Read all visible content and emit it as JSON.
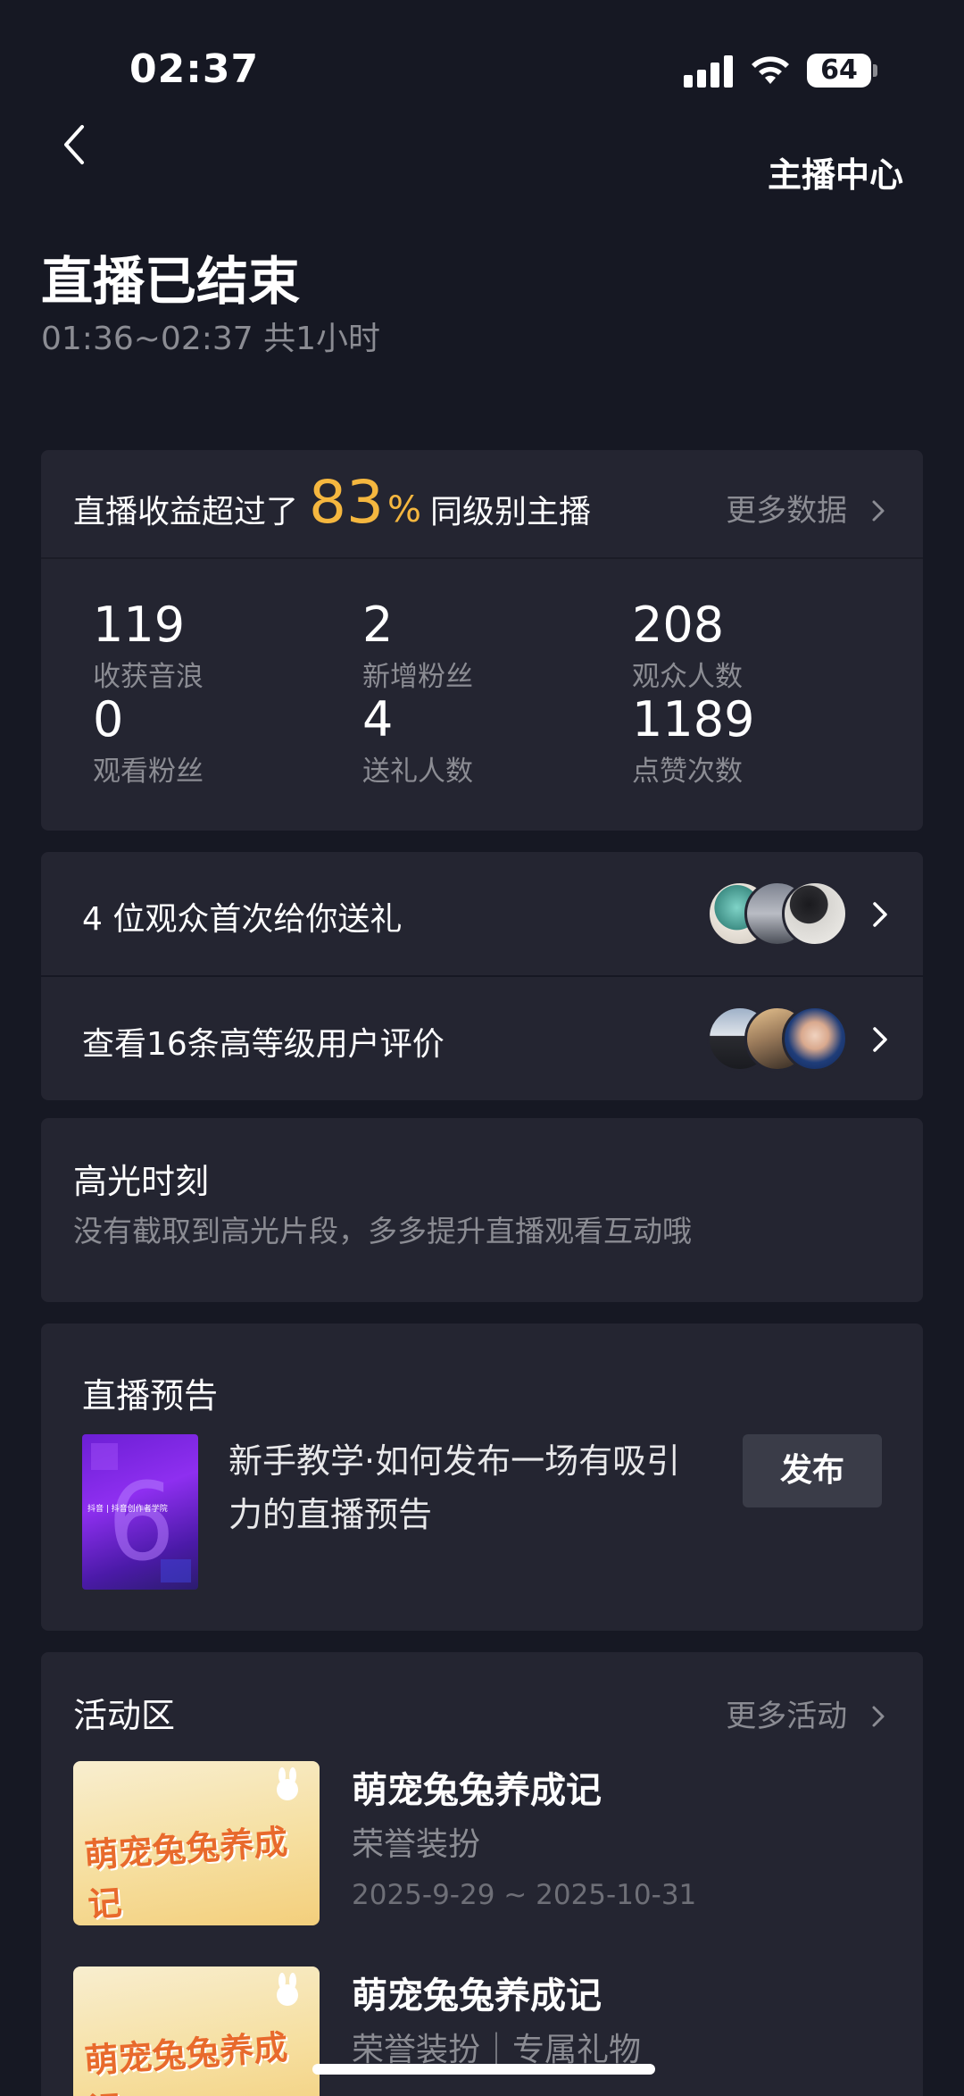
{
  "status_bar": {
    "time": "02:37",
    "battery": "64"
  },
  "header": {
    "anchor_center_label": "主播中心"
  },
  "page": {
    "title": "直播已结束",
    "subtitle": "01:36~02:37 共1小时"
  },
  "earnings": {
    "lead": "直播收益超过了",
    "percent": "83",
    "percent_sign": "%",
    "tail": "同级别主播",
    "more_label": "更多数据"
  },
  "stats": [
    {
      "value": "119",
      "label": "收获音浪"
    },
    {
      "value": "2",
      "label": "新增粉丝"
    },
    {
      "value": "208",
      "label": "观众人数"
    },
    {
      "value": "0",
      "label": "观看粉丝"
    },
    {
      "value": "4",
      "label": "送礼人数"
    },
    {
      "value": "1189",
      "label": "点赞次数"
    }
  ],
  "gift_row": {
    "text": "4 位观众首次给你送礼"
  },
  "review_row": {
    "text": "查看16条高等级用户评价"
  },
  "highlight": {
    "title": "高光时刻",
    "desc": "没有截取到高光片段，多多提升直播观看互动哦"
  },
  "preview": {
    "title": "直播预告",
    "desc": "新手教学·如何发布一场有吸引力的直播预告",
    "thumb_caption": "抖音 | 抖音创作者学院",
    "publish_label": "发布"
  },
  "activities": {
    "title": "活动区",
    "more_label": "更多活动",
    "items": [
      {
        "name": "萌宠兔兔养成记",
        "tag": "荣誉装扮",
        "date": "2025-9-29 ~ 2025-10-31",
        "thumb_text": "萌宠兔兔养成记"
      },
      {
        "name": "萌宠兔兔养成记",
        "tag": "荣誉装扮｜专属礼物",
        "date": "",
        "thumb_text": "萌宠兔兔养成记"
      }
    ]
  },
  "colors": {
    "background": "#161823",
    "card": "#242531",
    "accent": "#f5b73f",
    "muted": "#8b8c93"
  }
}
